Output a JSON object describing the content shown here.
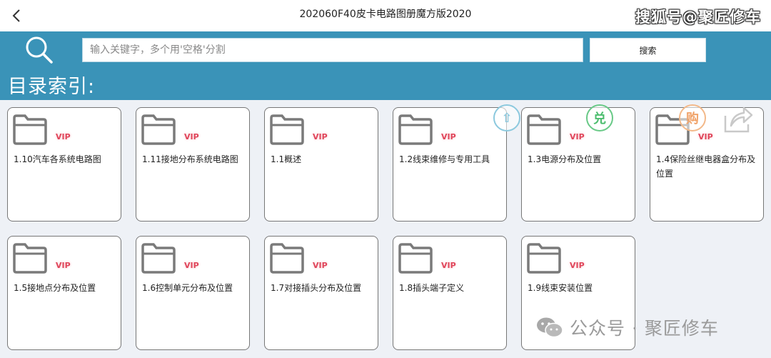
{
  "header": {
    "title": "202060F40皮卡电路图册魔方版2020",
    "watermark": "搜狐号@聚匠修车"
  },
  "search": {
    "placeholder": "输入关键字，多个用'空格'分割",
    "button_label": "搜索"
  },
  "section": {
    "title": "目录索引:"
  },
  "badge": "VIP",
  "float_icons": {
    "upgrade": "⇧",
    "exchange": "兑",
    "buy": "购"
  },
  "items": [
    {
      "label": "1.10汽车各系统电路图"
    },
    {
      "label": "1.11接地分布系统电路图"
    },
    {
      "label": "1.1概述"
    },
    {
      "label": "1.2线束维修与专用工具"
    },
    {
      "label": "1.3电源分布及位置"
    },
    {
      "label": "1.4保险丝继电器盒分布及位置"
    },
    {
      "label": "1.5接地点分布及位置"
    },
    {
      "label": "1.6控制单元分布及位置"
    },
    {
      "label": "1.7对接插头分布及位置"
    },
    {
      "label": "1.8插头端子定义"
    },
    {
      "label": "1.9线束安装位置"
    }
  ],
  "watermark_bottom": "公众号 · 聚匠修车",
  "colors": {
    "accent": "#3a93b8",
    "vip": "#e0455a",
    "folder": "#7a7a7a"
  }
}
